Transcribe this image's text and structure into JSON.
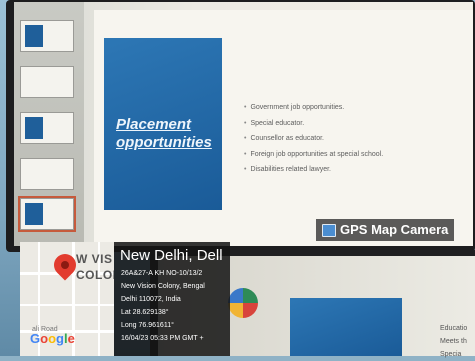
{
  "slide": {
    "title": "Placement opportunities",
    "bullets": [
      "Government job opportunities.",
      "Special educator.",
      "Counsellor as educator.",
      "Foreign job opportunities at special school.",
      "Disabilities related lawyer."
    ]
  },
  "bottom_slide": {
    "bullets": [
      "Educatio",
      "Meets th",
      "Specia"
    ]
  },
  "gps_badge": {
    "label": "GPS Map Camera",
    "icon": "image-icon"
  },
  "map": {
    "labels": [
      "W VIS",
      "COLON"
    ],
    "road_label": "ali Road",
    "logo": "Google"
  },
  "location": {
    "city": "New Delhi, Dell",
    "address_lines": [
      "26A&27-A KH NO-10/13/2",
      "New Vision Colony, Bengal",
      "Delhi 110072, India"
    ],
    "lat": "Lat 28.629138°",
    "long": "Long 76.961611°",
    "datetime": "16/04/23 05:33 PM GMT +"
  }
}
